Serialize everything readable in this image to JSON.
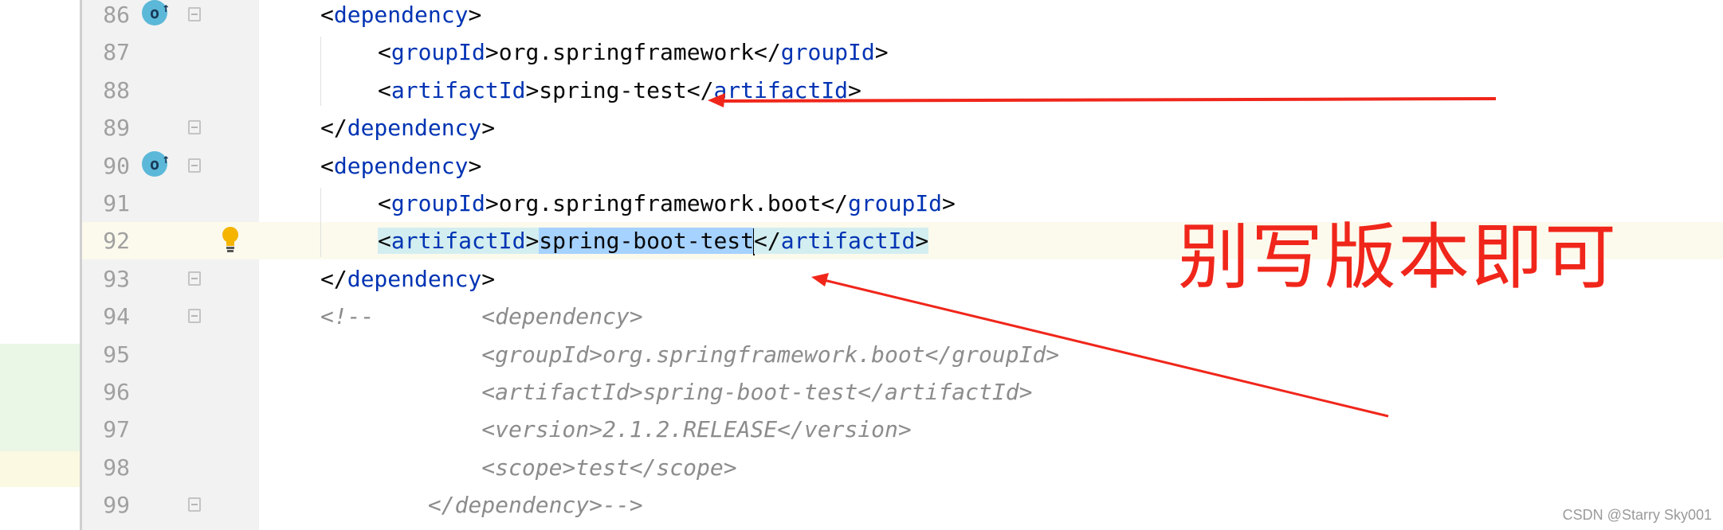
{
  "lines": [
    {
      "num": "86",
      "has_icon": true,
      "fold": true,
      "indent": 0,
      "parts": [
        [
          "p",
          "<"
        ],
        [
          "t",
          "dependency"
        ],
        [
          "p",
          ">"
        ]
      ]
    },
    {
      "num": "87",
      "indent": 1,
      "parts": [
        [
          "p",
          "<"
        ],
        [
          "t",
          "groupId"
        ],
        [
          "p",
          ">org.springframework</"
        ],
        [
          "t",
          "groupId"
        ],
        [
          "p",
          ">"
        ]
      ]
    },
    {
      "num": "88",
      "indent": 1,
      "parts": [
        [
          "p",
          "<"
        ],
        [
          "t",
          "artifactId"
        ],
        [
          "p",
          ">spring-test</"
        ],
        [
          "t",
          "artifactId"
        ],
        [
          "p",
          ">"
        ]
      ]
    },
    {
      "num": "89",
      "fold": true,
      "indent": 0,
      "parts": [
        [
          "p",
          "</"
        ],
        [
          "t",
          "dependency"
        ],
        [
          "p",
          ">"
        ]
      ]
    },
    {
      "num": "90",
      "has_icon": true,
      "fold": true,
      "indent": 0,
      "parts": [
        [
          "p",
          "<"
        ],
        [
          "t",
          "dependency"
        ],
        [
          "p",
          ">"
        ]
      ]
    },
    {
      "num": "91",
      "indent": 1,
      "parts": [
        [
          "p",
          "<"
        ],
        [
          "t",
          "groupId"
        ],
        [
          "p",
          ">org.springframework.boot</"
        ],
        [
          "t",
          "groupId"
        ],
        [
          "p",
          ">"
        ]
      ]
    },
    {
      "num": "92",
      "current": true,
      "bulb": true,
      "indent": 1,
      "parts": [
        [
          "hp",
          "<"
        ],
        [
          "ht",
          "artifactId"
        ],
        [
          "hp",
          ">"
        ],
        [
          "sel",
          "spring-boot-test"
        ],
        [
          "caret",
          ""
        ],
        [
          "hp",
          "</"
        ],
        [
          "ht",
          "artifactId"
        ],
        [
          "hp",
          ">"
        ]
      ]
    },
    {
      "num": "93",
      "fold": true,
      "indent": 0,
      "parts": [
        [
          "p",
          "</"
        ],
        [
          "t",
          "dependency"
        ],
        [
          "p",
          ">"
        ]
      ]
    },
    {
      "num": "94",
      "fold": true,
      "indent": 0,
      "parts": [
        [
          "c",
          "<!--        <dependency>"
        ]
      ]
    },
    {
      "num": "95",
      "indent": 0,
      "parts": [
        [
          "c",
          "            <groupId>org.springframework.boot</groupId>"
        ]
      ]
    },
    {
      "num": "96",
      "indent": 0,
      "parts": [
        [
          "c",
          "            <artifactId>spring-boot-test</artifactId>"
        ]
      ]
    },
    {
      "num": "97",
      "indent": 0,
      "parts": [
        [
          "c",
          "            <version>2.1.2.RELEASE</version>"
        ]
      ]
    },
    {
      "num": "98",
      "indent": 0,
      "parts": [
        [
          "c",
          "            <scope>test</scope>"
        ]
      ]
    },
    {
      "num": "99",
      "fold": true,
      "indent": 0,
      "parts": [
        [
          "c",
          "        </dependency>-->"
        ]
      ]
    }
  ],
  "annotation_text": "别写版本即可",
  "watermark": "CSDN @Starry Sky001",
  "colors": {
    "annotation": "#f0261b",
    "tag": "#0033b3",
    "comment": "#8c8c8c"
  }
}
